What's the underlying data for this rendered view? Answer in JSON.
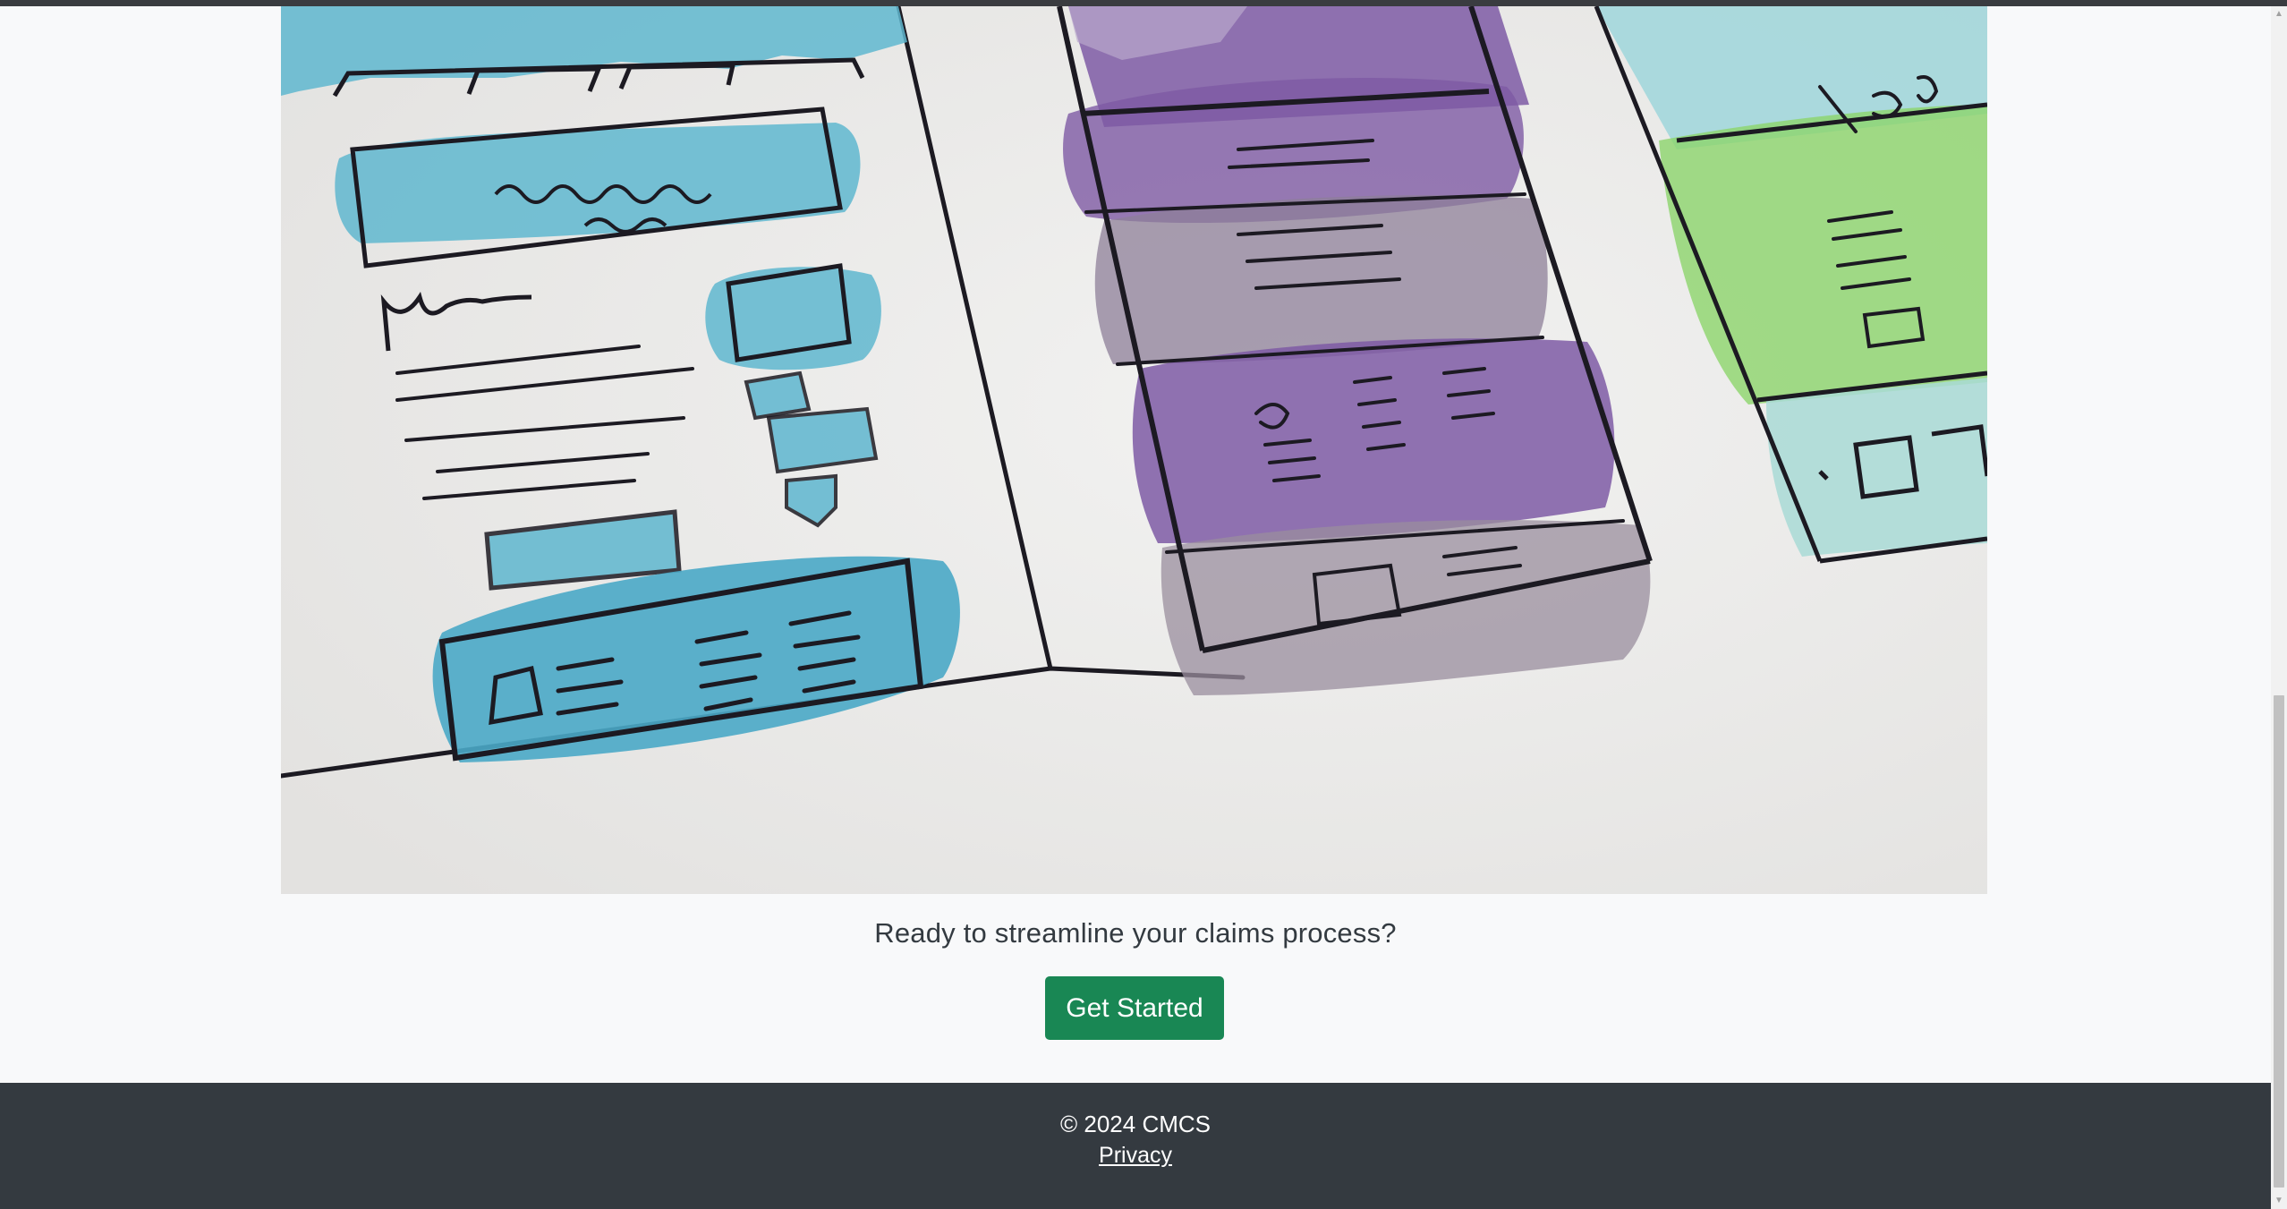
{
  "hero": {
    "image_alt": "Watercolor sketches of website wireframes"
  },
  "cta": {
    "tagline": "Ready to streamline your claims process?",
    "button_label": "Get Started"
  },
  "footer": {
    "copyright": "© 2024 CMCS",
    "privacy_label": "Privacy"
  },
  "colors": {
    "page_bg": "#f8f9fa",
    "button_bg": "#198754",
    "footer_bg": "#343a40",
    "text": "#333a40"
  },
  "icons": {
    "scroll_up": "▲",
    "scroll_down": "▼"
  }
}
